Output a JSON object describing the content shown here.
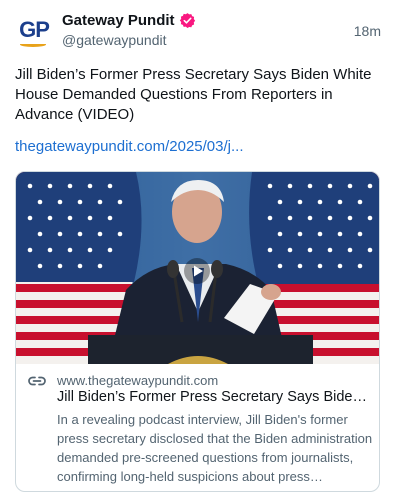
{
  "post": {
    "author": {
      "display_name": "Gateway Pundit",
      "handle": "@gatewaypundit",
      "avatar_text": "GP",
      "verified": true
    },
    "timestamp": "18m",
    "text": "Jill Biden’s Former Press Secretary Says Biden White House Demanded Questions From Reporters in Advance (VIDEO)",
    "link_text": "thegatewaypundit.com/2025/03/j..."
  },
  "card": {
    "domain": "www.thegatewaypundit.com",
    "title": "Jill Biden’s Former Press Secretary Says Biden White House Demanded Questions From Reporters in Advance (VIDEO)",
    "description": "In a revealing podcast interview, Jill Biden's former press secretary disclosed that the Biden administration demanded pre-screened questions from journalists, confirming long-held suspicions about press manipulation by the White House."
  },
  "colors": {
    "brand_blue": "#1c3f8c",
    "brand_orange": "#e8a21a",
    "verified_badge": "#f91880",
    "link": "#1d6fd1",
    "secondary_text": "#536471"
  },
  "icons": {
    "verified": "verified-badge-icon",
    "link": "link-icon",
    "play": "play-icon"
  }
}
